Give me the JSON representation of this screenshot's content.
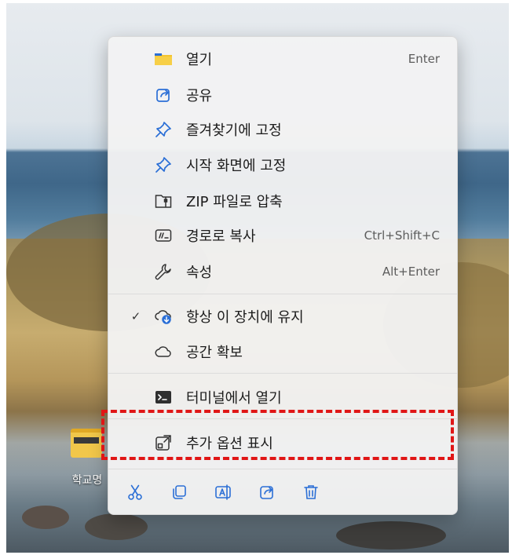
{
  "desktop": {
    "folder_label": "학교명"
  },
  "context_menu": {
    "items": [
      {
        "label": "열기",
        "shortcut": "Enter",
        "icon": "folder-icon"
      },
      {
        "label": "공유",
        "shortcut": "",
        "icon": "share-icon"
      },
      {
        "label": "즐겨찾기에 고정",
        "shortcut": "",
        "icon": "pin-icon"
      },
      {
        "label": "시작 화면에 고정",
        "shortcut": "",
        "icon": "pin-icon"
      },
      {
        "label": "ZIP 파일로 압축",
        "shortcut": "",
        "icon": "zip-icon"
      },
      {
        "label": "경로로 복사",
        "shortcut": "Ctrl+Shift+C",
        "icon": "copy-path-icon"
      },
      {
        "label": "속성",
        "shortcut": "Alt+Enter",
        "icon": "wrench-icon"
      },
      {
        "label": "항상 이 장치에 유지",
        "shortcut": "",
        "icon": "cloud-sync-icon",
        "checked": true
      },
      {
        "label": "공간 확보",
        "shortcut": "",
        "icon": "cloud-icon"
      },
      {
        "label": "터미널에서 열기",
        "shortcut": "",
        "icon": "terminal-icon"
      },
      {
        "label": "추가 옵션 표시",
        "shortcut": "",
        "icon": "more-options-icon"
      }
    ],
    "check_mark": "✓",
    "quick_actions": [
      "cut-icon",
      "copy-icon",
      "rename-icon",
      "share-icon",
      "delete-icon"
    ]
  },
  "colors": {
    "accent_blue": "#2b6fd6",
    "highlight_red": "#e01616",
    "folder_yellow": "#f4c430"
  }
}
